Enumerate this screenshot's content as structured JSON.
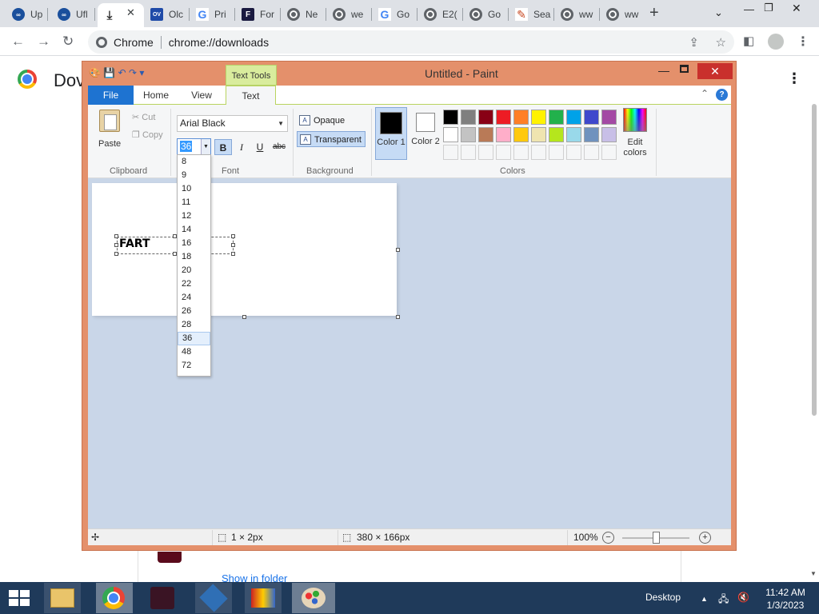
{
  "browser": {
    "tabs": [
      {
        "label": "Up",
        "icon": "upwork-icon"
      },
      {
        "label": "Ufl",
        "icon": "upwork-icon"
      },
      {
        "label": "",
        "icon": "download-icon"
      },
      {
        "label": "Olc",
        "icon": "ov-icon"
      },
      {
        "label": "Pri",
        "icon": "google-icon"
      },
      {
        "label": "For",
        "icon": "f-icon"
      },
      {
        "label": "Ne",
        "icon": "globe-icon"
      },
      {
        "label": "we",
        "icon": "globe-icon"
      },
      {
        "label": "Go",
        "icon": "google-icon"
      },
      {
        "label": "E2(",
        "icon": "globe-icon"
      },
      {
        "label": "Go",
        "icon": "globe-icon"
      },
      {
        "label": "Sea",
        "icon": "search-engine-icon"
      },
      {
        "label": "ww",
        "icon": "globe-icon"
      },
      {
        "label": "ww",
        "icon": "globe-icon"
      }
    ],
    "omnibox": {
      "site": "Chrome",
      "url": "chrome://downloads"
    }
  },
  "downloads_page": {
    "title": "Dov",
    "show_in_folder": "Show in folder"
  },
  "paint": {
    "title": "Untitled - Paint",
    "contextual_tab": "Text Tools",
    "ribbon_tabs": {
      "file": "File",
      "home": "Home",
      "view": "View",
      "text": "Text"
    },
    "clipboard": {
      "paste": "Paste",
      "cut": "Cut",
      "copy": "Copy",
      "group": "Clipboard"
    },
    "font": {
      "family": "Arial Black",
      "size": "36",
      "group": "Font",
      "bold": "B",
      "italic": "I",
      "underline": "U",
      "strike": "abc"
    },
    "background": {
      "opaque": "Opaque",
      "transparent": "Transparent",
      "group": "Background"
    },
    "colors": {
      "color1_label": "Color 1",
      "color2_label": "Color 2",
      "edit_colors": "Edit colors",
      "group": "Colors",
      "color1": "#000000",
      "color2": "#ffffff",
      "palette_row1": [
        "#000000",
        "#7f7f7f",
        "#880015",
        "#ed1c24",
        "#ff7f27",
        "#fff200",
        "#22b14c",
        "#00a2e8",
        "#3f48cc",
        "#a349a4"
      ],
      "palette_row2": [
        "#ffffff",
        "#c3c3c3",
        "#b97a57",
        "#ffaec9",
        "#ffc90e",
        "#efe4b0",
        "#b5e61d",
        "#99d9ea",
        "#7092be",
        "#c8bfe7"
      ]
    },
    "font_sizes": [
      "8",
      "9",
      "10",
      "11",
      "12",
      "14",
      "16",
      "18",
      "20",
      "22",
      "24",
      "26",
      "28",
      "36",
      "48",
      "72"
    ],
    "selected_size": "36",
    "canvas_text": "FART",
    "status": {
      "selection": "1 × 2px",
      "canvas_size": "380 × 166px",
      "zoom": "100%"
    }
  },
  "taskbar": {
    "desktop_label": "Desktop",
    "time": "11:42 AM",
    "date": "1/3/2023"
  }
}
